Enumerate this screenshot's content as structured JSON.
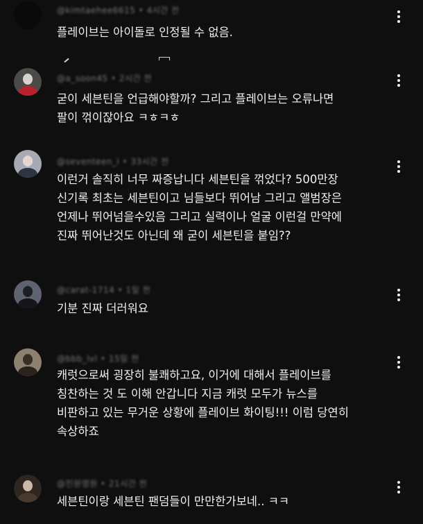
{
  "comments": [
    {
      "author": "@kimtaehee6615",
      "time": "4시간 전",
      "text": "플레이브는 아이돌로 인정될 수 없음."
    },
    {
      "author": "@a_soon45",
      "time": "2시간 전",
      "text": "굳이 세븐틴을 언급해야할까? 그리고 플레이브는 오류나면\n팔이 꺾이잖아요 ㅋㅎㅋㅎ"
    },
    {
      "author": "@seventeen_l",
      "time": "33시간 전",
      "text": "이런거 솔직히 너무 짜증납니다 세븐틴을 꺾었다? 500만장\n신기록 최초는 세븐틴이고 님들보다 뛰어남 그리고 앨범장은\n언제나 뛰어넘을수있음 그리고 실력이나 얼굴 이런걸 만약에\n진짜 뛰어난것도 아닌데 왜 굳이 세븐틴을 붙임??"
    },
    {
      "author": "@carat-1714",
      "time": "1일 전",
      "text": "기분 진짜 더러워요"
    },
    {
      "author": "@bbb_lvl",
      "time": "15일 전",
      "text": "캐럿으로써 굉장히 불쾌하고요, 이거에 대해서 플레이브를\n칭찬하는 것 도 이해 안갑니다 지금 캐럿 모두가 뉴스를\n비판하고 있는 무거운 상황에 플레이브 화이팅!!! 이럼 당연히\n속상하죠"
    },
    {
      "author": "@진원영원",
      "time": "21시간 전",
      "text": "세븐틴이랑 세븐틴 팬덤들이 만만한가보네.. ㅋㅋ"
    }
  ],
  "icons": {
    "more": "more-vert-icon",
    "avatar": "avatar-icon"
  },
  "colors": {
    "background": "#0f0f0f",
    "text": "#f1f1f1",
    "meta": "#7a7a7a"
  }
}
